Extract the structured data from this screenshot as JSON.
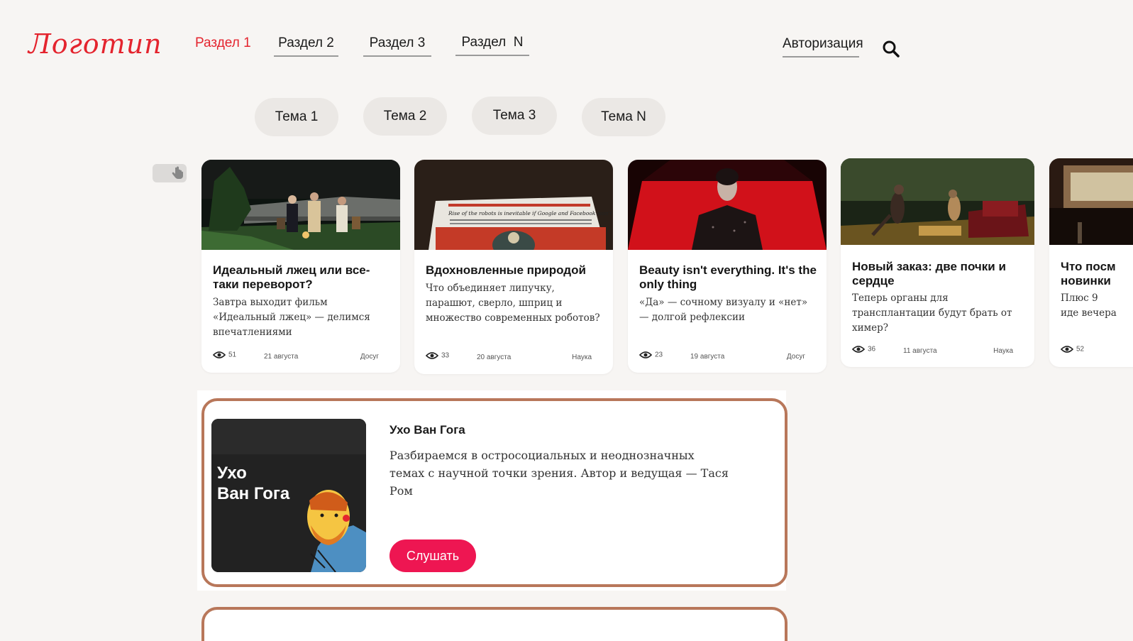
{
  "header": {
    "logo": "Логотип",
    "nav": [
      "Раздел 1",
      "Раздел 2",
      "Раздел 3",
      "Раздел  N"
    ],
    "auth": "Авторизация",
    "search_icon": "search-icon",
    "accent": "#e4242e"
  },
  "topics": [
    "Тема 1",
    "Тема 2",
    "Тема 3",
    "Тема N"
  ],
  "cards": [
    {
      "title": "Идеальный лжец или все-таки переворот?",
      "desc": "Завтра выходит фильм «Идеальный лжец» — делимся впечатлениями",
      "views": "51",
      "date": "21 августа",
      "category": "Досуг"
    },
    {
      "title": "Вдохновленные природой",
      "desc": "Что объединяет липучку, парашют, сверло, шприц и множество современных роботов?",
      "views": "33",
      "date": "20 августа",
      "category": "Наука"
    },
    {
      "title": "Beauty isn't everything. It's the only thing",
      "desc": "«Да» — сочному визуалу и «нет» — долгой рефлексии",
      "views": "23",
      "date": "19 августа",
      "category": "Досуг"
    },
    {
      "title": "Новый заказ: две почки и сердце",
      "desc": "Теперь органы для трансплантации будут брать от химер?",
      "views": "36",
      "date": "11 августа",
      "category": "Наука"
    },
    {
      "title": "Что посм новинки",
      "desc": "Плюс 9 иде вечера",
      "views": "52",
      "date": "",
      "category": ""
    }
  ],
  "podcast": {
    "cover_text": "Ухо Ван Гога",
    "title": "Ухо Ван Гога",
    "desc": "Разбираемся в остросоциальных и неоднозначных темах с научной точки зрения. Автор и ведущая — Тася Ром",
    "button": "Слушать",
    "button_color": "#ee1652",
    "border_color": "#b8775a"
  },
  "newspaper_headline": "Rise of the robots is inevitable if Google and Facebook won't say who is behind their clicks"
}
